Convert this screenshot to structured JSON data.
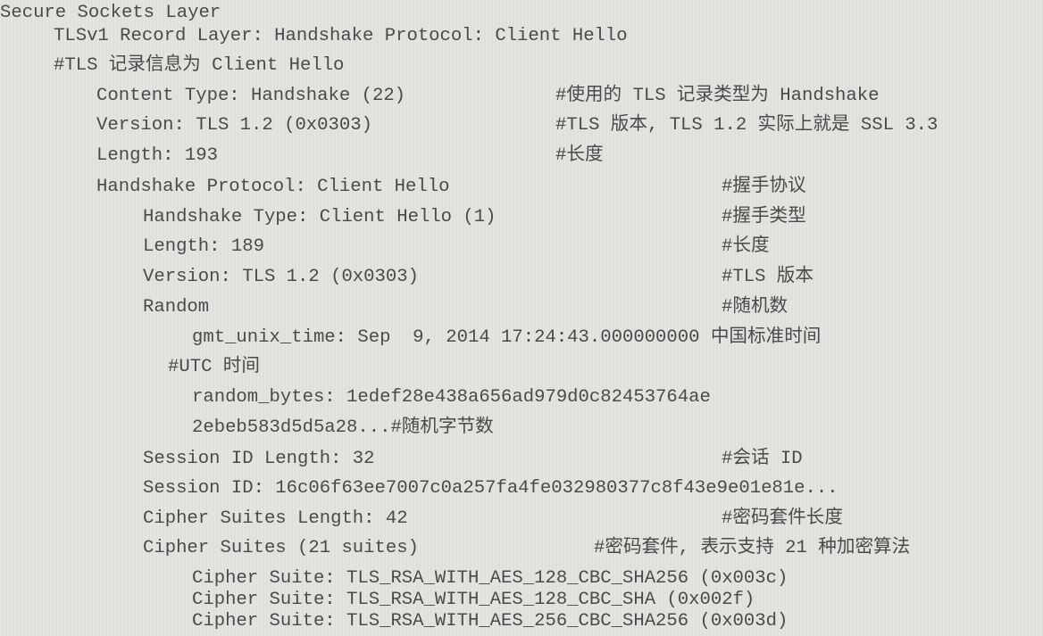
{
  "document": {
    "title": "Secure Sockets Layer",
    "lines": [
      {
        "text": "Secure Sockets Layer",
        "comment": ""
      },
      {
        "text": "TLSv1 Record Layer: Handshake Protocol: Client Hello",
        "comment": ""
      },
      {
        "text": "#TLS 记录信息为 Client Hello",
        "comment": ""
      },
      {
        "text": "Content Type: Handshake (22)",
        "comment": "#使用的 TLS 记录类型为 Handshake"
      },
      {
        "text": "Version: TLS 1.2 (0x0303)",
        "comment": "#TLS 版本, TLS 1.2 实际上就是 SSL 3.3"
      },
      {
        "text": "Length: 193",
        "comment": "#长度"
      },
      {
        "text": "Handshake Protocol: Client Hello",
        "comment": "#握手协议"
      },
      {
        "text": "Handshake Type: Client Hello (1)",
        "comment": "#握手类型"
      },
      {
        "text": "Length: 189",
        "comment": "#长度"
      },
      {
        "text": "Version: TLS 1.2 (0x0303)",
        "comment": "#TLS 版本"
      },
      {
        "text": "Random",
        "comment": "#随机数"
      },
      {
        "text": "gmt_unix_time: Sep  9, 2014 17:24:43.000000000 中国标准时间",
        "comment": ""
      },
      {
        "text": "#UTC 时间",
        "comment": ""
      },
      {
        "text": "random_bytes: 1edef28e438a656ad979d0c82453764ae",
        "comment": ""
      },
      {
        "text": "2ebeb583d5d5a28...#随机字节数",
        "comment": ""
      },
      {
        "text": "Session ID Length: 32",
        "comment": "#会话 ID"
      },
      {
        "text": "Session ID: 16c06f63ee7007c0a257fa4fe032980377c8f43e9e01e81e...",
        "comment": ""
      },
      {
        "text": "Cipher Suites Length: 42",
        "comment": "#密码套件长度"
      },
      {
        "text": "Cipher Suites (21 suites)",
        "comment": "#密码套件, 表示支持 21 种加密算法"
      },
      {
        "text": "Cipher Suite: TLS_RSA_WITH_AES_128_CBC_SHA256 (0x003c)",
        "comment": ""
      },
      {
        "text": "Cipher Suite: TLS_RSA_WITH_AES_128_CBC_SHA (0x002f)",
        "comment": ""
      },
      {
        "text": "Cipher Suite: TLS_RSA_WITH_AES_256_CBC_SHA256 (0x003d)",
        "comment": ""
      }
    ]
  }
}
